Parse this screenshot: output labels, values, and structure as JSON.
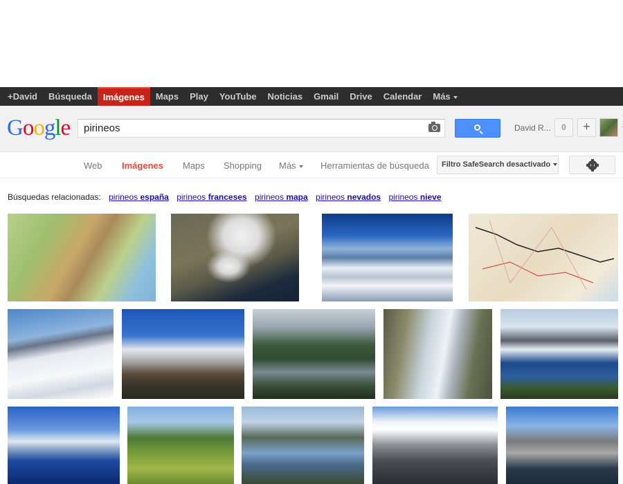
{
  "topbar": {
    "items": [
      {
        "label": "+David",
        "active": false
      },
      {
        "label": "Búsqueda",
        "active": false
      },
      {
        "label": "Imágenes",
        "active": true
      },
      {
        "label": "Maps",
        "active": false
      },
      {
        "label": "Play",
        "active": false
      },
      {
        "label": "YouTube",
        "active": false
      },
      {
        "label": "Noticias",
        "active": false
      },
      {
        "label": "Gmail",
        "active": false
      },
      {
        "label": "Drive",
        "active": false
      },
      {
        "label": "Calendar",
        "active": false
      }
    ],
    "more_label": "Más"
  },
  "header": {
    "logo_text": "Google",
    "search_query": "pirineos",
    "user_name": "David R...",
    "notification_count": "0",
    "share_label": "+"
  },
  "tabs": {
    "items": [
      {
        "label": "Web",
        "active": false
      },
      {
        "label": "Imágenes",
        "active": true
      },
      {
        "label": "Maps",
        "active": false
      },
      {
        "label": "Shopping",
        "active": false
      },
      {
        "label": "Más",
        "active": false
      },
      {
        "label": "Herramientas de búsqueda",
        "active": false
      }
    ],
    "safesearch_label": "Filtro SafeSearch desactivado"
  },
  "related": {
    "label": "Búsquedas relacionadas:",
    "links": [
      {
        "prefix": "pirineos",
        "bold": "españa"
      },
      {
        "prefix": "pirineos",
        "bold": "franceses"
      },
      {
        "prefix": "pirineos",
        "bold": "mapa"
      },
      {
        "prefix": "pirineos",
        "bold": "nevados"
      },
      {
        "prefix": "pirineos",
        "bold": "nieve"
      }
    ]
  },
  "images": [
    {
      "kind": "relief-map"
    },
    {
      "kind": "satellite"
    },
    {
      "kind": "aerial-snow"
    },
    {
      "kind": "road-map"
    },
    {
      "kind": "snow-peaks"
    },
    {
      "kind": "snow-peaks-blue"
    },
    {
      "kind": "lake-forest"
    },
    {
      "kind": "waterfall"
    },
    {
      "kind": "mountain-lake"
    },
    {
      "kind": "moonlit-lake"
    },
    {
      "kind": "meadow"
    },
    {
      "kind": "valley-lake"
    },
    {
      "kind": "rocky-peaks"
    },
    {
      "kind": "alpine-lake"
    }
  ],
  "colors": {
    "accent": "#dd4b39",
    "topbar_bg": "#2d2d2d",
    "search_button": "#4d90fe",
    "link": "#1a0dab",
    "logo_blue": "#3369e8",
    "logo_red": "#d50f25",
    "logo_yellow": "#eeb211",
    "logo_green": "#009925"
  }
}
